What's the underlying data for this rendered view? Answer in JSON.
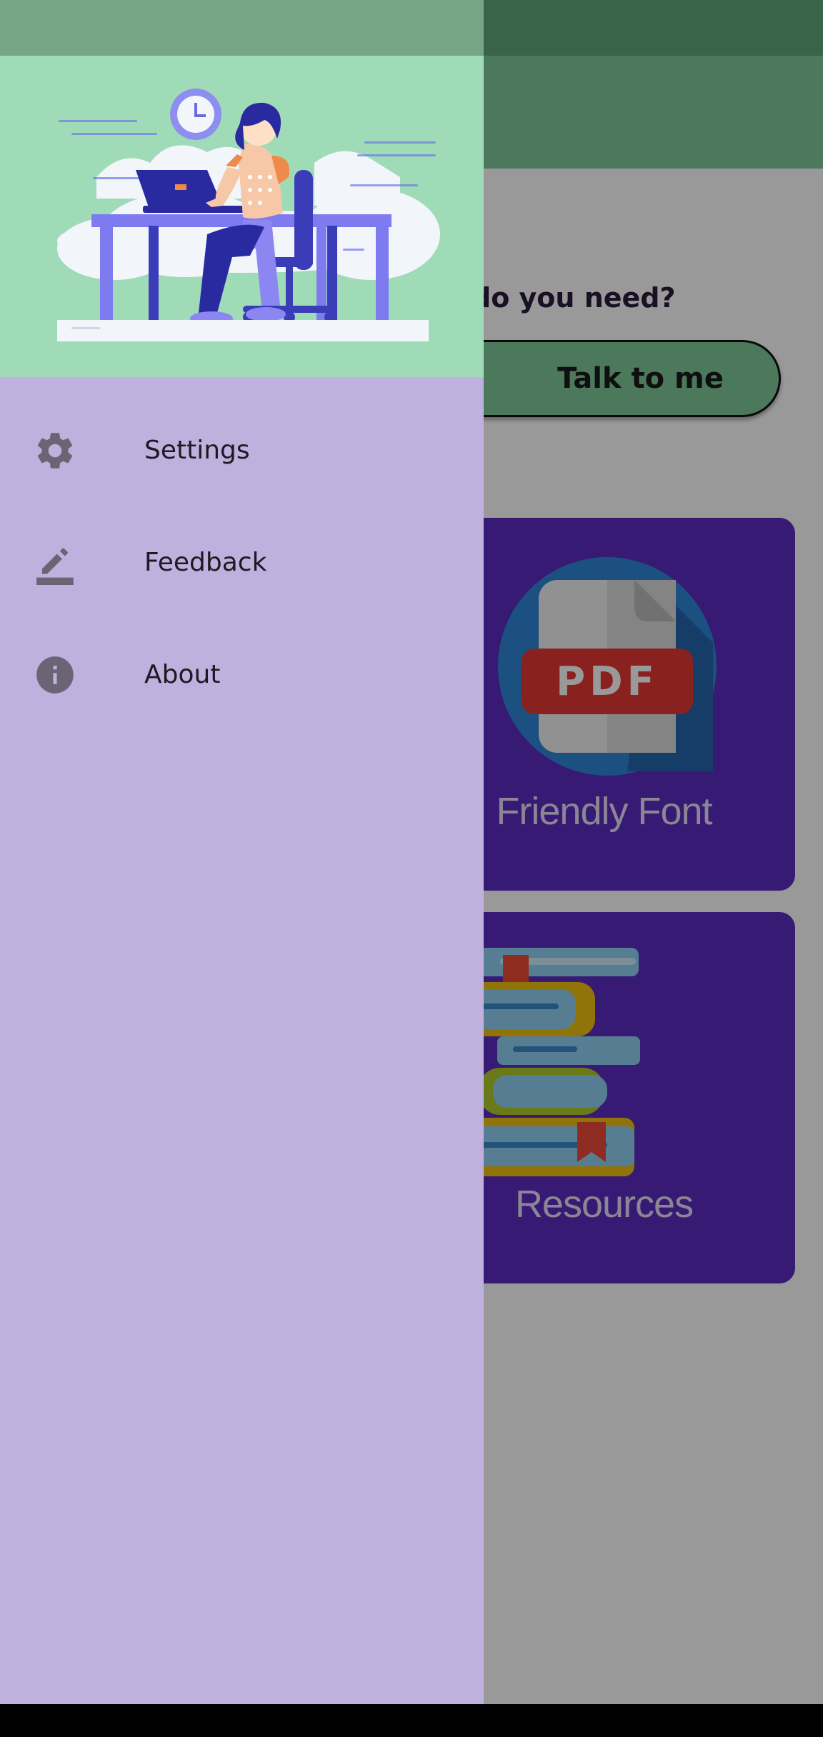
{
  "app": {
    "question_text": "do you need?",
    "talk_button_label": "Talk to me",
    "cards": [
      {
        "label": "Friendly Font",
        "icon": "pdf-file-icon",
        "icon_text": "PDF"
      },
      {
        "label": "Resources",
        "icon": "books-stack-icon"
      }
    ]
  },
  "drawer": {
    "header_image": "person-at-desk-illustration",
    "items": [
      {
        "label": "Settings",
        "icon": "gear-icon"
      },
      {
        "label": "Feedback",
        "icon": "edit-pencil-icon"
      },
      {
        "label": "About",
        "icon": "info-icon"
      }
    ]
  },
  "colors": {
    "appbar": "#7fc99a",
    "drawer_header": "#a0dbb8",
    "drawer_background": "#c0b0de",
    "card": "#5a2cc2"
  }
}
